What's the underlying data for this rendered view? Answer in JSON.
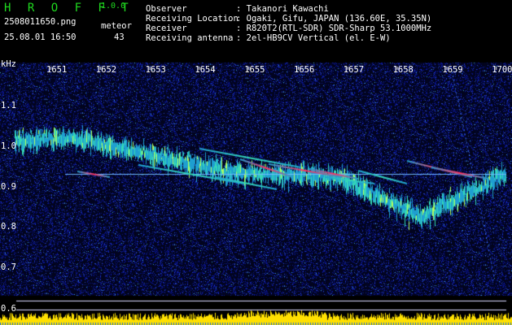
{
  "app": {
    "name": "H R O F F T",
    "version": "1.0.0"
  },
  "file": {
    "name": "2508011650.png",
    "datetime": "25.08.01 16:50"
  },
  "counter": {
    "label": "meteor",
    "value": "43"
  },
  "info": [
    {
      "label": "Observer",
      "value": ": Takanori Kawachi"
    },
    {
      "label": "Receiving Location",
      "value": ": Ogaki, Gifu, JAPAN (136.60E, 35.35N)"
    },
    {
      "label": "Receiver",
      "value": ": R820T2(RTL-SDR) SDR-Sharp 53.1000MHz"
    },
    {
      "label": "Receiving antenna",
      "value": ": 2el-HB9CV Vertical (el. E-W)"
    }
  ],
  "axis": {
    "unit": "kHz",
    "x_ticks": [
      "1651",
      "1652",
      "1653",
      "1654",
      "1655",
      "1656",
      "1657",
      "1658",
      "1659",
      "1700"
    ],
    "y_ticks": [
      "1.1",
      "1.0",
      "0.9",
      "0.8",
      "0.7",
      "0.6"
    ]
  },
  "colors": {
    "logo": "#1fd81f",
    "background": "#000000",
    "noise": "#0d1a7a",
    "signal_mid": "#2fd0c0",
    "signal_hot": "#ff3060",
    "level_bar": "#ffe000"
  }
}
